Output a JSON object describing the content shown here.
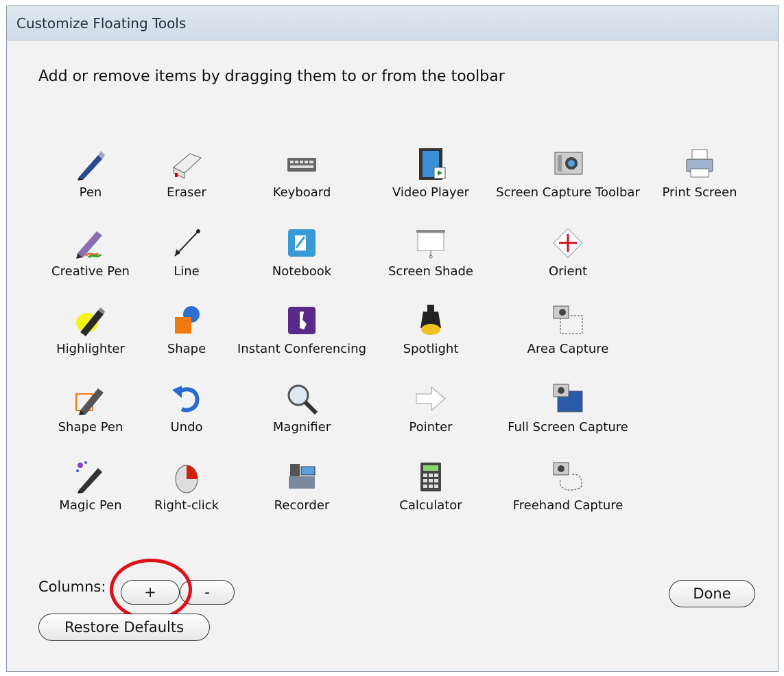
{
  "window": {
    "title": "Customize Floating Tools"
  },
  "instructions": "Add or remove items by dragging them to or from the toolbar",
  "tools": [
    {
      "label": "Pen",
      "icon": "pen-icon"
    },
    {
      "label": "Eraser",
      "icon": "eraser-icon"
    },
    {
      "label": "Keyboard",
      "icon": "keyboard-icon"
    },
    {
      "label": "Video Player",
      "icon": "video-player-icon"
    },
    {
      "label": "Screen Capture Toolbar",
      "icon": "camera-icon"
    },
    {
      "label": "Print Screen",
      "icon": "printer-icon"
    },
    {
      "label": "Creative Pen",
      "icon": "creative-pen-icon"
    },
    {
      "label": "Line",
      "icon": "line-icon"
    },
    {
      "label": "Notebook",
      "icon": "notebook-icon"
    },
    {
      "label": "Screen Shade",
      "icon": "screen-shade-icon"
    },
    {
      "label": "Orient",
      "icon": "orient-icon"
    },
    {
      "label": "Highlighter",
      "icon": "highlighter-icon"
    },
    {
      "label": "Shape",
      "icon": "shape-icon"
    },
    {
      "label": "Instant Conferencing",
      "icon": "conferencing-icon"
    },
    {
      "label": "Spotlight",
      "icon": "spotlight-icon"
    },
    {
      "label": "Area Capture",
      "icon": "area-capture-icon"
    },
    {
      "label": "Shape Pen",
      "icon": "shape-pen-icon"
    },
    {
      "label": "Undo",
      "icon": "undo-icon"
    },
    {
      "label": "Magnifier",
      "icon": "magnifier-icon"
    },
    {
      "label": "Pointer",
      "icon": "pointer-icon"
    },
    {
      "label": "Full Screen Capture",
      "icon": "full-screen-capture-icon"
    },
    {
      "label": "Magic Pen",
      "icon": "magic-pen-icon"
    },
    {
      "label": "Right-click",
      "icon": "right-click-icon"
    },
    {
      "label": "Recorder",
      "icon": "recorder-icon"
    },
    {
      "label": "Calculator",
      "icon": "calculator-icon"
    },
    {
      "label": "Freehand Capture",
      "icon": "freehand-capture-icon"
    }
  ],
  "footer": {
    "columns_label": "Columns:",
    "plus_label": "+",
    "minus_label": "-",
    "restore_label": "Restore Defaults",
    "done_label": "Done"
  },
  "annotation": {
    "color": "#e0101a"
  }
}
